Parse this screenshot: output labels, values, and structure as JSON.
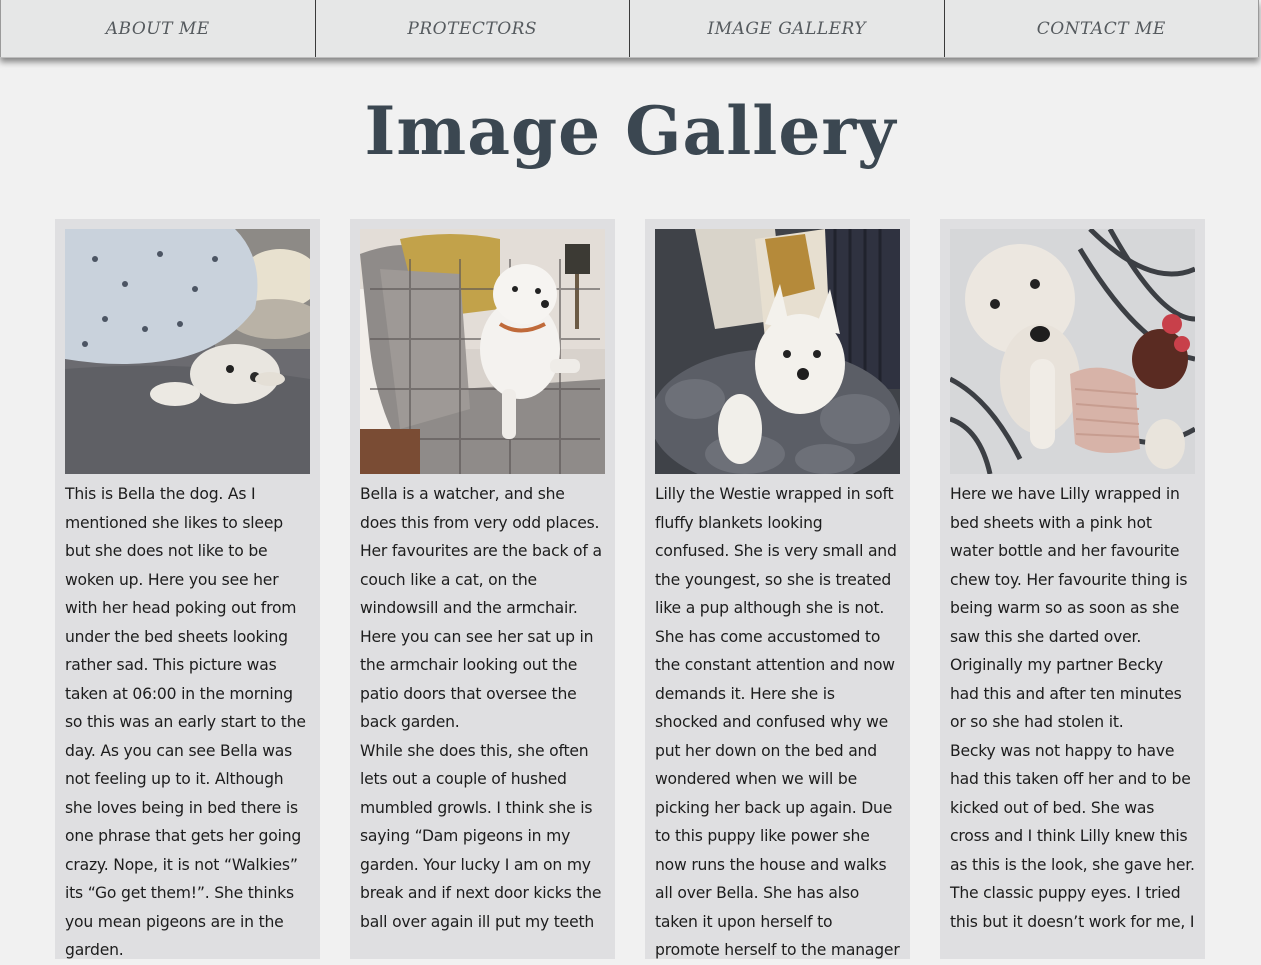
{
  "nav": {
    "items": [
      {
        "label": "ABOUT ME"
      },
      {
        "label": "PROTECTORS"
      },
      {
        "label": "IMAGE GALLERY"
      },
      {
        "label": "CONTACT ME"
      }
    ]
  },
  "page": {
    "title": "Image Gallery"
  },
  "gallery": [
    {
      "paragraphs": [
        "This is Bella the dog. As I mentioned she likes to sleep but she does not like to be woken up. Here you see her with her head poking out from under the bed sheets looking rather sad. This picture was taken at 06:00 in the morning so this was an early start to the day. As you can see Bella was not feeling up to it. Although she loves being in bed there is one phrase that gets her going crazy. Nope, it is not “Walkies” its “Go get them!”. She thinks you mean pigeons are in the garden."
      ]
    },
    {
      "paragraphs": [
        "Bella is a watcher, and she does this from very odd places. Her favourites are the back of a couch like a cat, on the windowsill and the armchair. Here you can see her sat up in the armchair looking out the patio doors that oversee the back garden.",
        "While she does this, she often lets out a couple of hushed mumbled growls. I think she is saying “Dam pigeons in my garden. Your lucky I am on my break and if next door kicks the ball over again ill put my teeth"
      ]
    },
    {
      "paragraphs": [
        "Lilly the Westie wrapped in soft fluffy blankets looking confused. She is very small and the youngest, so she is treated like a pup although she is not. She has come accustomed to the constant attention and now demands it. Here she is shocked and confused why we put her down on the bed and wondered when we will be picking her back up again. Due to this puppy like power she now runs the house and walks all over Bella. She has also taken it upon herself to promote herself to the manager"
      ]
    },
    {
      "paragraphs": [
        "Here we have Lilly wrapped in bed sheets with a pink hot water bottle and her favourite chew toy. Her favourite thing is being warm so as soon as she saw this she darted over. Originally my partner Becky had this and after ten minutes or so she had stolen it.",
        "Becky was not happy to have had this taken off her and to be kicked out of bed. She was cross and I think Lilly knew this as this is the look, she gave her. The classic puppy eyes. I tried this but it doesn’t work for me, I"
      ]
    }
  ],
  "colors": {
    "nav_bg": "#e6e7e7",
    "page_bg": "#f1f1f1",
    "card_bg": "#dfdfe1",
    "title": "#3b4751"
  }
}
